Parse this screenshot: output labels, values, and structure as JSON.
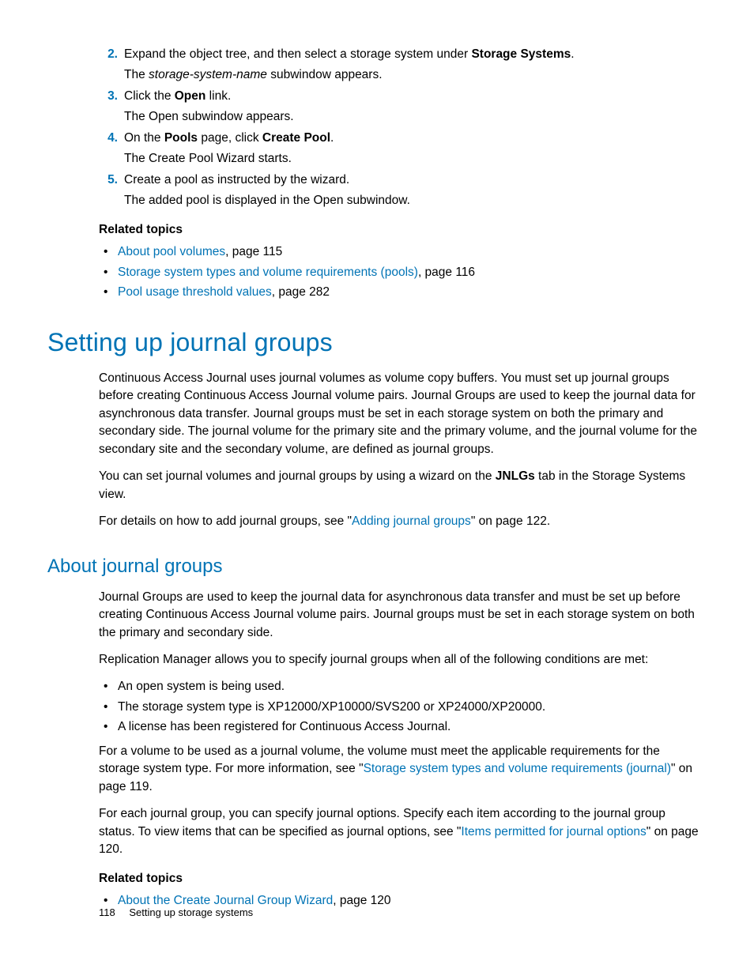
{
  "steps": [
    {
      "num": "2.",
      "line1_pre": "Expand the object tree, and then select a storage system under ",
      "line1_bold": "Storage Systems",
      "line1_post": ".",
      "line2_pre": "The ",
      "line2_italic": "storage-system-name",
      "line2_post": " subwindow appears."
    },
    {
      "num": "3.",
      "line1_pre": "Click the ",
      "line1_bold": "Open",
      "line1_post": " link.",
      "line2": "The Open subwindow appears."
    },
    {
      "num": "4.",
      "line1_pre": "On the ",
      "line1_bold1": "Pools",
      "line1_mid": " page, click ",
      "line1_bold2": "Create Pool",
      "line1_post": ".",
      "line2": "The Create Pool Wizard starts."
    },
    {
      "num": "5.",
      "line1": "Create a pool as instructed by the wizard.",
      "line2": "The added pool is displayed in the Open subwindow."
    }
  ],
  "related1": {
    "heading": "Related topics",
    "items": [
      {
        "link": "About pool volumes",
        "suffix": ", page 115"
      },
      {
        "link": "Storage system types and volume requirements (pools)",
        "suffix": ", page 116"
      },
      {
        "link": "Pool usage threshold values",
        "suffix": ", page 282"
      }
    ]
  },
  "section": {
    "title": "Setting up journal groups",
    "p1": "Continuous Access Journal uses journal volumes as volume copy buffers. You must set up journal groups before creating Continuous Access Journal volume pairs. Journal Groups are used to keep the journal data for asynchronous data transfer. Journal groups must be set in each storage system on both the primary and secondary side. The journal volume for the primary site and the primary volume, and the journal volume for the secondary site and the secondary volume, are defined as journal groups.",
    "p2_pre": "You can set journal volumes and journal groups by using a wizard on the ",
    "p2_bold": "JNLGs",
    "p2_post": " tab in the Storage Systems view.",
    "p3_pre": " For details on how to add journal groups, see \"",
    "p3_link": "Adding journal groups",
    "p3_post": "\" on page 122."
  },
  "subsection": {
    "title": "About journal groups",
    "p1": "Journal Groups are used to keep the journal data for asynchronous data transfer and must be set up before creating Continuous Access Journal volume pairs. Journal groups must be set in each storage system on both the primary and secondary side.",
    "p2": "Replication Manager allows you to specify journal groups when all of the following conditions are met:",
    "conditions": [
      "An open system is being used.",
      "The storage system type is XP12000/XP10000/SVS200 or XP24000/XP20000.",
      "A license has been registered for Continuous Access Journal."
    ],
    "p3_pre": "For a volume to be used as a journal volume, the volume must meet the applicable requirements for the storage system type. For more information, see \"",
    "p3_link": "Storage system types and volume requirements (journal)",
    "p3_post": "\" on page 119.",
    "p4_pre": "For each journal group, you can specify journal options. Specify each item according to the journal group status. To view items that can be specified as journal options, see \"",
    "p4_link": "Items permitted for journal options",
    "p4_post": "\" on page 120."
  },
  "related2": {
    "heading": "Related topics",
    "items": [
      {
        "link": "About the Create Journal Group Wizard",
        "suffix": ", page 120"
      }
    ]
  },
  "footer": {
    "page": "118",
    "title": "Setting up storage systems"
  }
}
